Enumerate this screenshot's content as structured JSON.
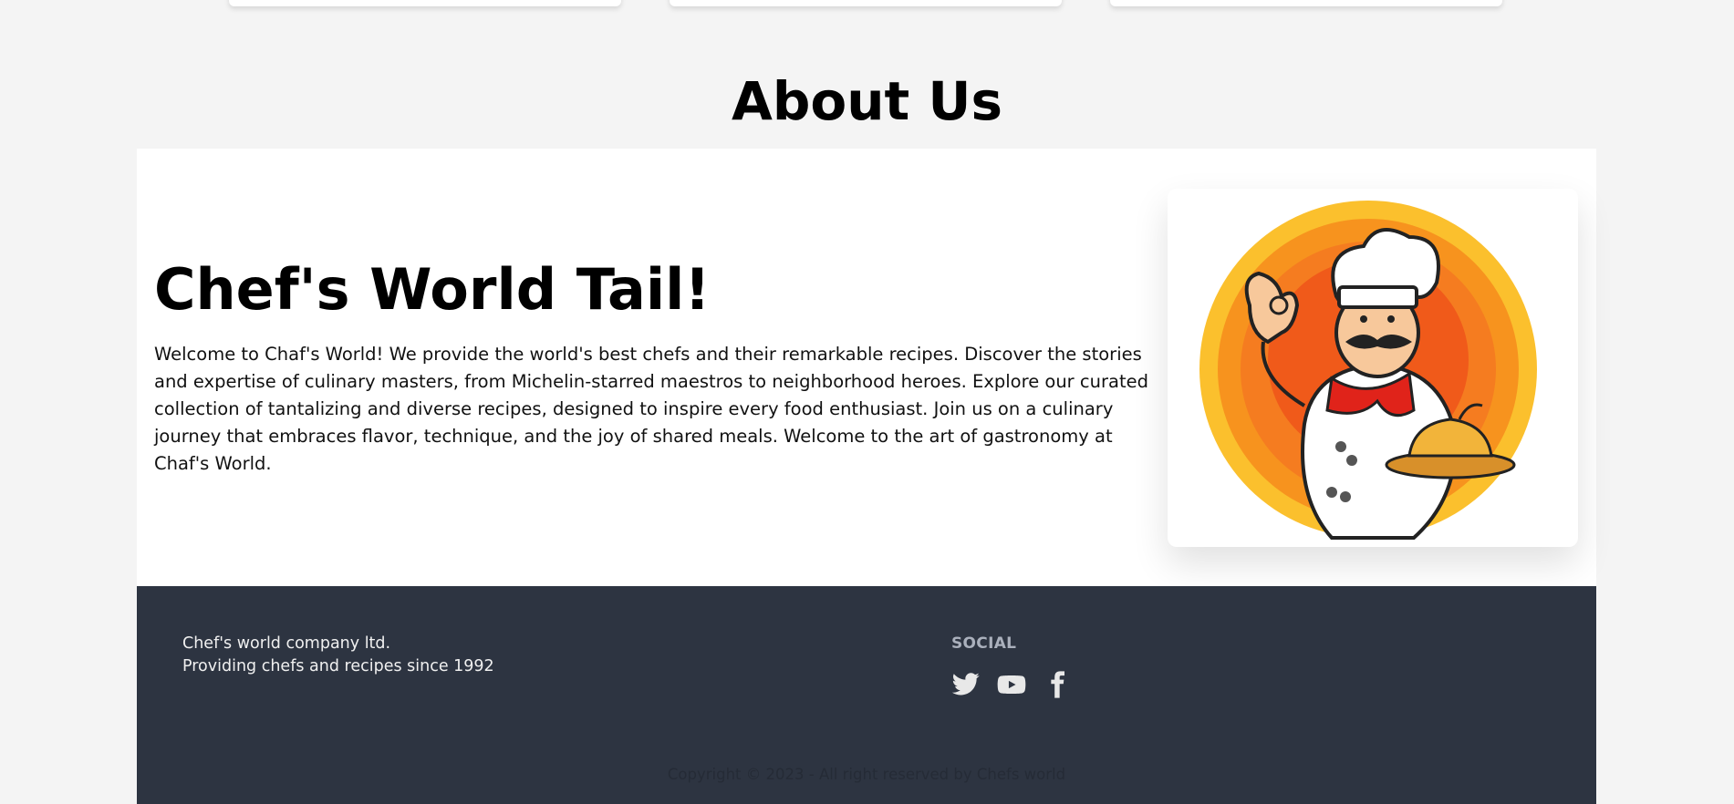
{
  "about": {
    "title": "About Us",
    "heading": "Chef's World Tail!",
    "text": "Welcome to Chaf's World! We provide the world's best chefs and their remarkable recipes. Discover the stories and expertise of culinary masters, from Michelin-starred maestros to neighborhood heroes. Explore our curated collection of tantalizing and diverse recipes, designed to inspire every food enthusiast. Join us on a culinary journey that embraces flavor, technique, and the joy of shared meals. Welcome to the art of gastronomy at Chaf's World.",
    "image_icon": "chef-mascot-illustration"
  },
  "footer": {
    "company_line1": "Chef's world company ltd.",
    "company_line2": "Providing chefs and recipes since 1992",
    "social_title": "SOCIAL",
    "social_icons": [
      "twitter-icon",
      "youtube-icon",
      "facebook-icon"
    ],
    "copyright": "Copyright © 2023 - All right reserved by Chefs world"
  },
  "colors": {
    "page_background": "#f4f4f4",
    "footer_background": "#2d3441",
    "accent_orange": "#f7931e",
    "accent_yellow": "#fbc02d"
  }
}
